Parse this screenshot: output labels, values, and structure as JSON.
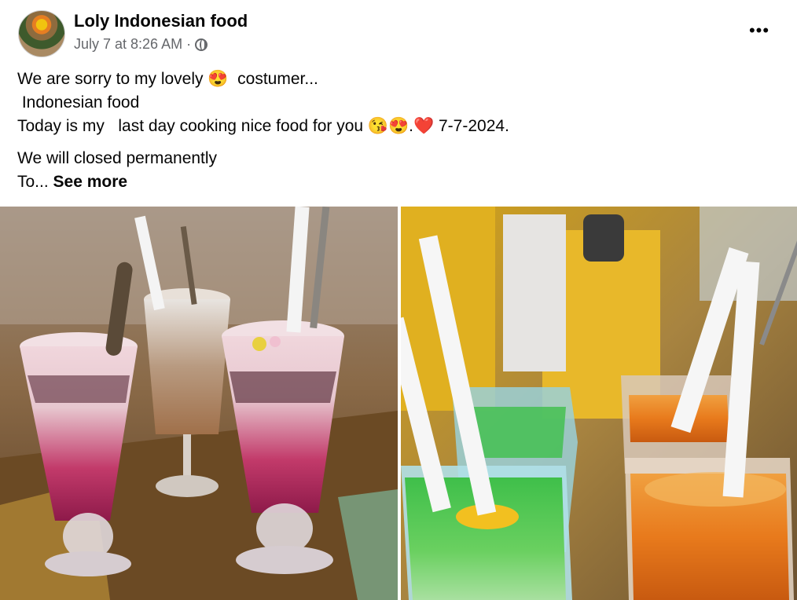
{
  "post": {
    "page_name": "Loly Indonesian food",
    "timestamp": "July 7 at 8:26 AM",
    "separator": "·",
    "audience_icon": "globe-icon",
    "more_icon": "more-options-icon",
    "more_label": "•••",
    "text_lines": [
      "We are sorry to my lovely 😍  costumer...",
      " Indonesian food",
      "Today is my   last day cooking nice food for you 😘😍.❤️ 7-7-2024."
    ],
    "text_lines_2": [
      "We will closed permanently"
    ],
    "truncated_prefix": "To... ",
    "see_more_label": "See more"
  },
  "photos": [
    {
      "name": "photo-dessert-drinks",
      "description_icon": "photo"
    },
    {
      "name": "photo-iced-drinks",
      "description_icon": "photo"
    }
  ]
}
